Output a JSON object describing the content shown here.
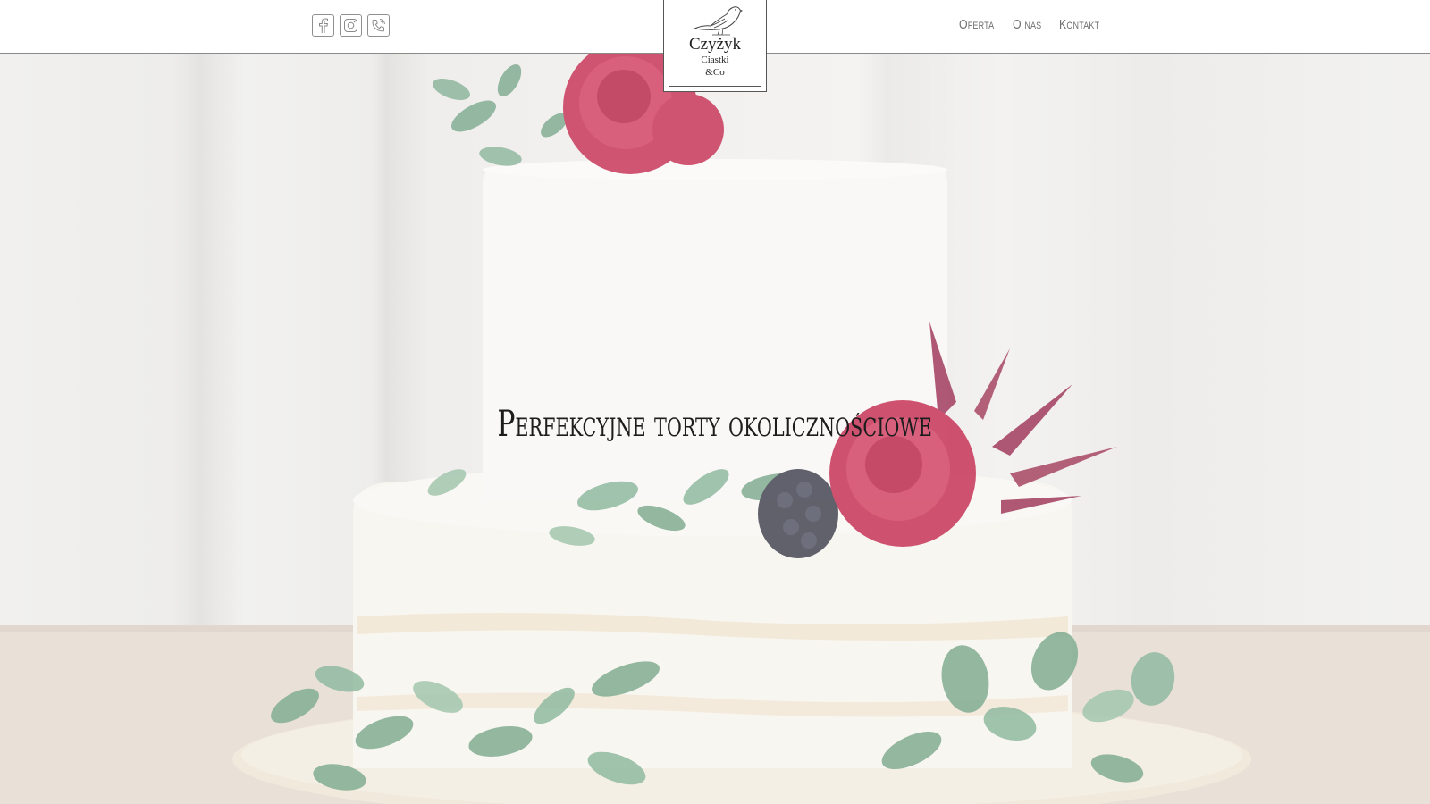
{
  "header": {
    "socials": [
      {
        "icon": "facebook-icon",
        "label": "f"
      },
      {
        "icon": "instagram-icon",
        "label": ""
      },
      {
        "icon": "phone-icon",
        "label": ""
      }
    ],
    "logo": {
      "name": "Czyżyk",
      "line2": "Ciastki",
      "line3": "&Co"
    },
    "nav": [
      {
        "label": "Oferta"
      },
      {
        "label": "O nas"
      },
      {
        "label": "Kontakt"
      }
    ]
  },
  "hero": {
    "headline": "Perfekcyjne torty okolicznościowe"
  },
  "colors": {
    "header_bg": "#ffffff",
    "header_border": "#8a8a8a",
    "text_dark": "#1d1d1d",
    "nav_text": "#6e6e6e",
    "flower_red": "#c2244a",
    "leaf_green": "#6f9a7c"
  }
}
